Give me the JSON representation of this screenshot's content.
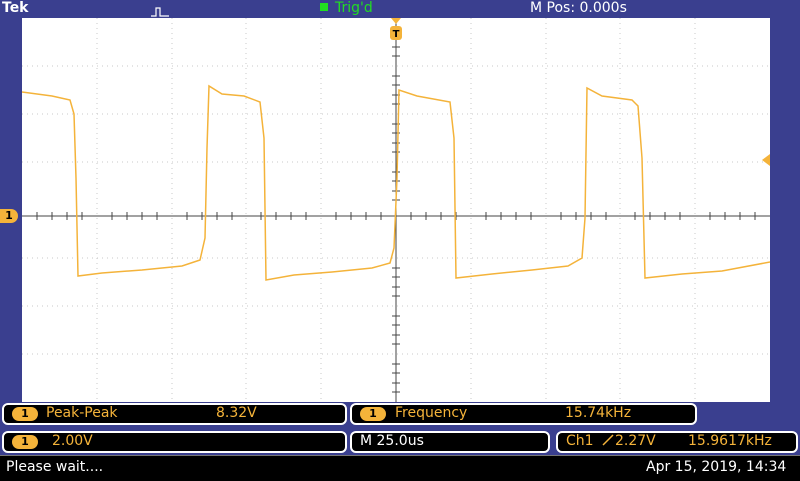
{
  "header": {
    "brand": "Tek",
    "trigger_state": "Trig'd",
    "m_pos": "M Pos: 0.000s"
  },
  "channel_marker": "1",
  "measurements": [
    {
      "channel": "1",
      "name": "Peak-Peak",
      "value": "8.32V"
    },
    {
      "channel": "1",
      "name": "Frequency",
      "value": "15.74kHz"
    }
  ],
  "settings": {
    "channel": "1",
    "volts_div": "2.00V",
    "timebase": "M 25.0us",
    "trigger_source": "Ch1",
    "trigger_level": "2.27V",
    "trigger_freq": "15.9617kHz"
  },
  "status": {
    "message": "Please wait....",
    "datetime": "Apr 15, 2019, 14:34"
  },
  "colors": {
    "trace": "#f4b33a",
    "background": "#3a3f8f",
    "trigger_status": "#22dd22"
  }
}
